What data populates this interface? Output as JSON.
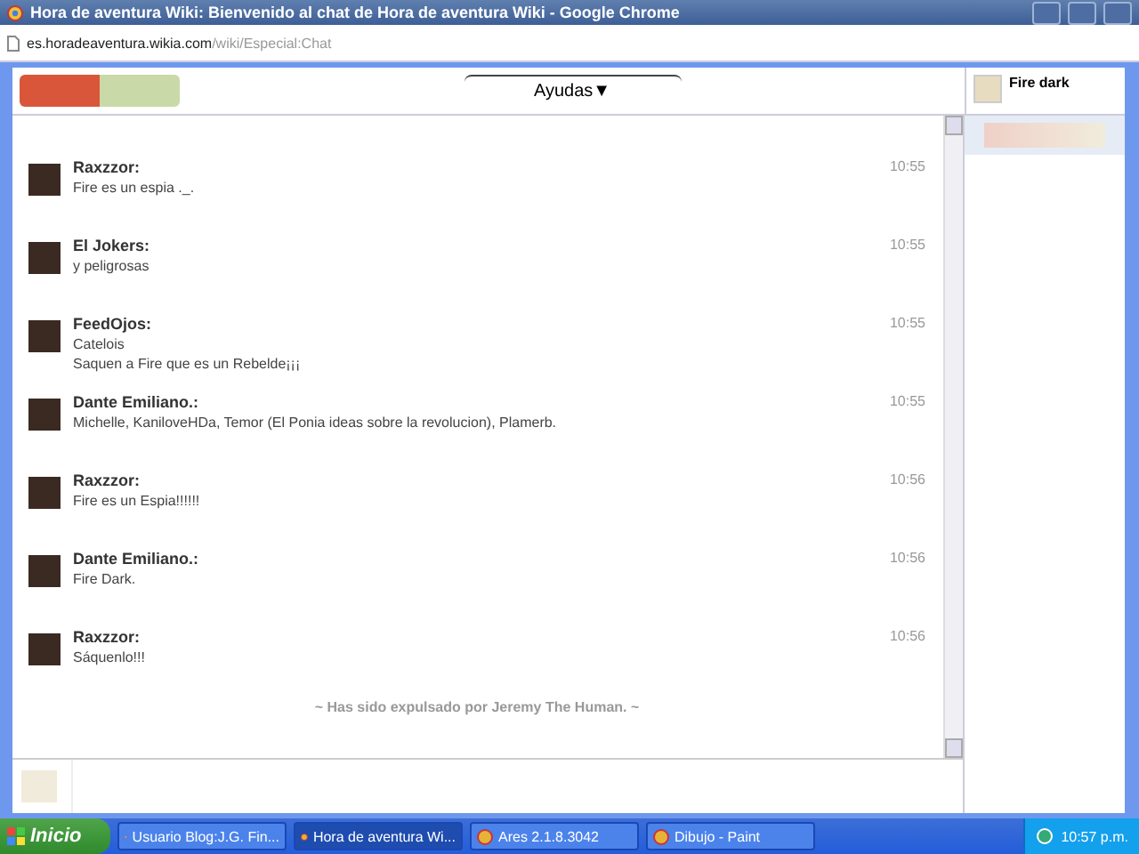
{
  "window": {
    "title": "Hora de aventura Wiki: Bienvenido al chat de Hora de aventura Wiki - Google Chrome"
  },
  "address": {
    "host": "es.horadeaventura.wikia.com",
    "path": "/wiki/Especial:Chat"
  },
  "header": {
    "menu": "Ayudas▼",
    "user": "Fire dark"
  },
  "messages": [
    {
      "name": "Raxzzor:",
      "time": "10:55",
      "lines": [
        "Fire es un espia ._."
      ]
    },
    {
      "name": "El Jokers:",
      "time": "10:55",
      "lines": [
        "y peligrosas"
      ]
    },
    {
      "name": "FeedOjos:",
      "time": "10:55",
      "lines": [
        "Catelois",
        "Saquen a Fire que es un Rebelde¡¡¡"
      ]
    },
    {
      "name": "Dante Emiliano.:",
      "time": "10:55",
      "lines": [
        "Michelle, KaniloveHDa, Temor (El Ponia ideas sobre la revolucion), Plamerb."
      ]
    },
    {
      "name": "Raxzzor:",
      "time": "10:56",
      "lines": [
        "Fire es un Espia!!!!!!"
      ]
    },
    {
      "name": "Dante Emiliano.:",
      "time": "10:56",
      "lines": [
        "Fire Dark."
      ]
    },
    {
      "name": "Raxzzor:",
      "time": "10:56",
      "lines": [
        "Sáquenlo!!!"
      ]
    }
  ],
  "notice": "~ Has sido expulsado por Jeremy The Human. ~",
  "taskbar": {
    "start": "Inicio",
    "tasks": [
      {
        "label": "Usuario Blog:J.G. Fin...",
        "selected": false
      },
      {
        "label": "Hora de aventura Wi...",
        "selected": true
      },
      {
        "label": "Ares 2.1.8.3042",
        "selected": false
      },
      {
        "label": "Dibujo - Paint",
        "selected": false
      }
    ],
    "clock": "10:57 p.m."
  }
}
